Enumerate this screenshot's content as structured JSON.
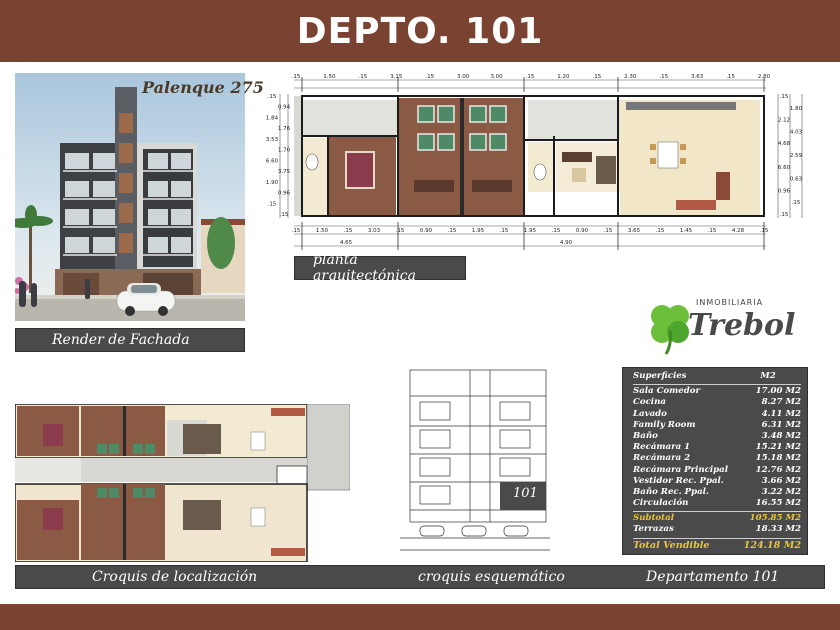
{
  "header": {
    "title": "DEPTO. 101"
  },
  "facade": {
    "brand": "Palenque 275",
    "caption": "Render de Fachada"
  },
  "plan": {
    "caption": "planta arquitectónica",
    "top_dims": [
      ".15",
      "1.50",
      ".15",
      "3.15",
      ".15",
      "3.00",
      "3.00",
      ".15",
      "1.20",
      ".15",
      "2.30",
      ".15",
      "3.63",
      ".15",
      "2.80"
    ],
    "bottom_dims": [
      ".15",
      "1.50",
      ".15",
      "3.03",
      ".15",
      "0.90",
      ".15",
      "1.95",
      ".15",
      "1.95",
      ".15",
      "0.90",
      ".15",
      "3.65",
      ".15",
      "1.45",
      ".15",
      "4.28",
      ".15"
    ],
    "bottom_totals": [
      "4.65",
      "4.90"
    ],
    "left_dims": [
      ".15",
      "0.94",
      "1.84",
      "1.76",
      "3.53",
      "1.70",
      "6.60",
      "3.75",
      "1.90",
      "0.96",
      ".15",
      ".15"
    ],
    "right_dims": [
      ".15",
      "1.80",
      "2.12",
      "4.03",
      "4.68",
      "2.59",
      "6.60",
      "0.63",
      "0.96",
      ".15",
      ".15"
    ]
  },
  "logo": {
    "company": "INMOBILIARIA",
    "name": "Trebol"
  },
  "areas": {
    "header": {
      "label": "Superficies",
      "unit": "M2"
    },
    "rows": [
      {
        "label": "Sala Comedor",
        "value": "17.00  M2"
      },
      {
        "label": "Cocina",
        "value": "8.27  M2"
      },
      {
        "label": "Lavado",
        "value": "4.11  M2"
      },
      {
        "label": "Family Room",
        "value": "6.31  M2"
      },
      {
        "label": "Baño",
        "value": "3.48  M2"
      },
      {
        "label": "Recámara  1",
        "value": "15.21  M2"
      },
      {
        "label": "Recámara  2",
        "value": "15.18  M2"
      },
      {
        "label": "Recámara  Principal",
        "value": "12.76  M2"
      },
      {
        "label": "Vestidor Rec. Ppal.",
        "value": "3.66  M2"
      },
      {
        "label": "Baño Rec. Ppal.",
        "value": "3.22  M2"
      },
      {
        "label": "Circulación",
        "value": "16.55 M2"
      }
    ],
    "subtotal": {
      "label": "Subtotal",
      "value": "105.85 M2"
    },
    "terraces": {
      "label": "Terrazas",
      "value": "18.33 M2"
    },
    "total": {
      "label": "Total Vendible",
      "value": "124.18 M2"
    }
  },
  "schematic": {
    "unit_label": "101"
  },
  "captions": {
    "location": "Croquis  de  localización",
    "schematic": "croquis  esquemático",
    "department": "Departamento  101"
  },
  "colors": {
    "banner": "#7a4331",
    "caption_bar": "#4a4a4a",
    "accent_gold": "#e8c43a",
    "wood_floor": "#8a5a44",
    "tile_floor": "#f2e6c8"
  }
}
